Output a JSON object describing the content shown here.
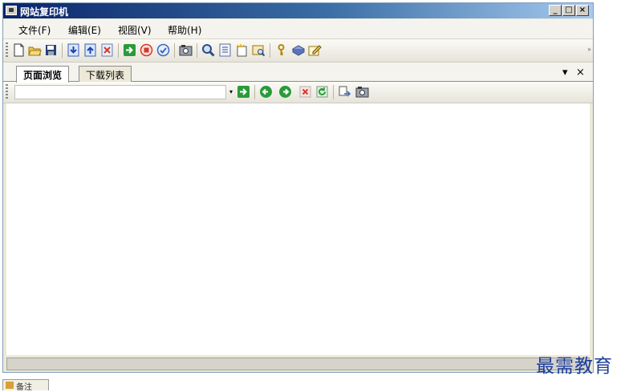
{
  "window": {
    "title": "网站复印机"
  },
  "title_buttons": {
    "minimize": "_",
    "restore": "□",
    "close": "×"
  },
  "menu": {
    "items": [
      {
        "label": "文件(F)"
      },
      {
        "label": "编辑(E)"
      },
      {
        "label": "视图(V)"
      },
      {
        "label": "帮助(H)"
      }
    ]
  },
  "toolbar": {
    "icons": [
      "new-file-icon",
      "open-folder-icon",
      "save-icon",
      "import-icon",
      "export-icon",
      "delete-icon",
      "go-icon",
      "stop-icon",
      "check-icon",
      "camera-icon",
      "search-icon",
      "list-icon",
      "new-item-icon",
      "browse-icon",
      "key-icon",
      "book-icon",
      "edit-icon"
    ]
  },
  "tabs": [
    {
      "label": "页面浏览",
      "active": true
    },
    {
      "label": "下载列表",
      "active": false
    }
  ],
  "tab_controls": {
    "dropdown": "▾",
    "close": "×"
  },
  "address_bar": {
    "value": "",
    "dropdown": "▾"
  },
  "nav_icons": [
    "go-icon",
    "back-icon",
    "forward-icon",
    "stop-page-icon",
    "refresh-icon",
    "copy-icon",
    "snapshot-icon"
  ],
  "status_bar": {
    "text": ""
  },
  "watermark": {
    "text": "最需教育"
  },
  "taskbar": {
    "label": "备注"
  },
  "colors": {
    "title_start": "#0a246a",
    "title_end": "#a6caf0",
    "go_green": "#2b9a3a",
    "stop_red": "#d23a2a",
    "watermark": "#1d3f9c"
  }
}
